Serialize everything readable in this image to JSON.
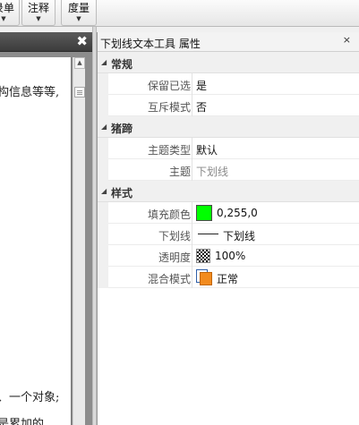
{
  "toolbar": {
    "buttons": [
      {
        "label": "录单"
      },
      {
        "label": "注释"
      },
      {
        "label": "度量"
      }
    ],
    "dropdown_glyph": "▼"
  },
  "document": {
    "close_glyph": "✖",
    "lines": [
      "构信息等等,",
      "、一个对象;",
      "是累加的,"
    ]
  },
  "properties": {
    "title": "下划线文本工具 属性",
    "close_glyph": "×",
    "collapse_glyph": "◢",
    "categories": [
      {
        "label": "常规",
        "props": [
          {
            "name": "保留已选",
            "value": "是"
          },
          {
            "name": "互斥模式",
            "value": "否"
          }
        ]
      },
      {
        "label": "猪蹄",
        "props": [
          {
            "name": "主题类型",
            "value": "默认"
          },
          {
            "name": "主题",
            "value": "下划线"
          }
        ]
      },
      {
        "label": "样式",
        "props": [
          {
            "name": "填充颜色",
            "value": "0,255,0",
            "color": "#00ff00"
          },
          {
            "name": "下划线",
            "value": "下划线"
          },
          {
            "name": "透明度",
            "value": "100%"
          },
          {
            "name": "混合模式",
            "value": "正常"
          }
        ]
      }
    ]
  }
}
